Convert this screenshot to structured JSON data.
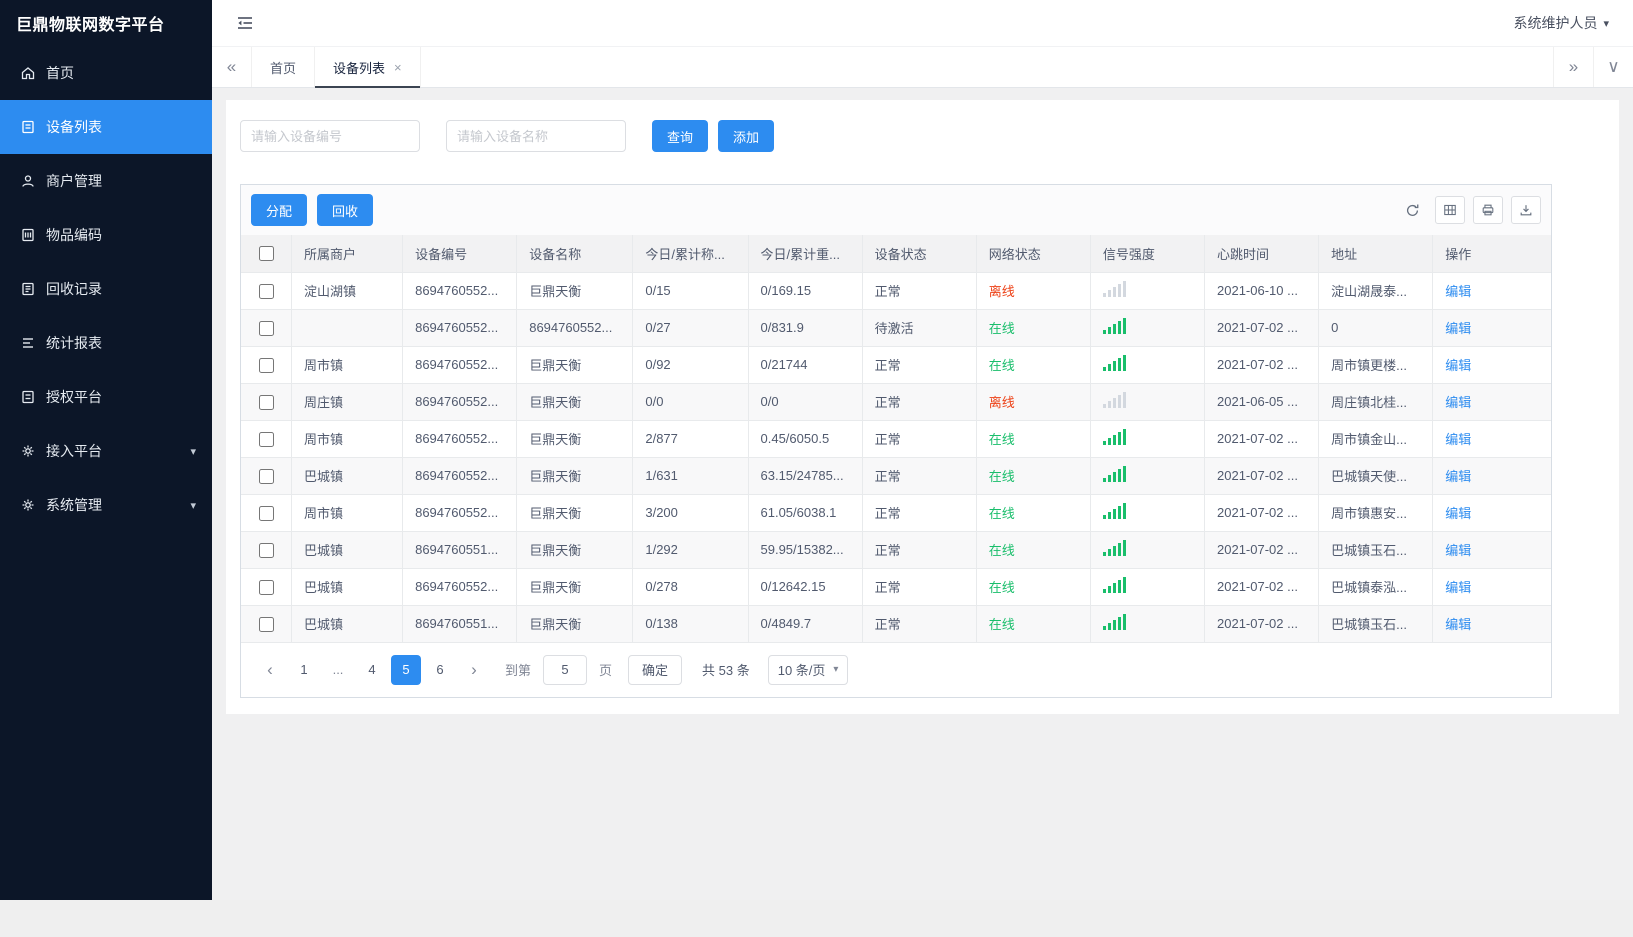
{
  "app": {
    "title": "巨鼎物联网数字平台"
  },
  "topbar": {
    "user": "系统维护人员"
  },
  "colors": {
    "accent": "#2d8cf0",
    "online_green": "#19be6b",
    "offline_red": "#ed3f14",
    "sidebar_bg": "#0c1628"
  },
  "icons": {
    "user_dropdown_arrow": "▾",
    "menu_expand_arrow": "▾",
    "tab_close": "×",
    "tab_scroll_left": "«",
    "tab_scroll_right": "»",
    "tab_list_arrow": "∨",
    "select_arrow": "▾"
  },
  "sidebar": {
    "items": [
      {
        "label": "首页",
        "icon": "home-icon",
        "active": false
      },
      {
        "label": "设备列表",
        "icon": "device-list-icon",
        "active": true
      },
      {
        "label": "商户管理",
        "icon": "merchant-icon",
        "active": false
      },
      {
        "label": "物品编码",
        "icon": "item-code-icon",
        "active": false
      },
      {
        "label": "回收记录",
        "icon": "recycle-record-icon",
        "active": false
      },
      {
        "label": "统计报表",
        "icon": "report-icon",
        "active": false
      },
      {
        "label": "授权平台",
        "icon": "auth-platform-icon",
        "active": false
      },
      {
        "label": "接入平台",
        "icon": "access-platform-icon",
        "active": false,
        "expandable": true
      },
      {
        "label": "系统管理",
        "icon": "system-manage-icon",
        "active": false,
        "expandable": true
      }
    ]
  },
  "tabs": {
    "items": [
      {
        "label": "首页",
        "active": false,
        "closable": false
      },
      {
        "label": "设备列表",
        "active": true,
        "closable": true
      }
    ]
  },
  "search": {
    "device_no_placeholder": "请输入设备编号",
    "device_name_placeholder": "请输入设备名称",
    "query_label": "查询",
    "add_label": "添加"
  },
  "toolbar": {
    "assign_label": "分配",
    "recycle_label": "回收"
  },
  "table": {
    "headers": [
      "所属商户",
      "设备编号",
      "设备名称",
      "今日/累计称...",
      "今日/累计重...",
      "设备状态",
      "网络状态",
      "信号强度",
      "心跳时间",
      "地址",
      "操作"
    ],
    "edit_label": "编辑",
    "rows": [
      {
        "merchant": "淀山湖镇",
        "device_no": "8694760552...",
        "device_name": "巨鼎天衡",
        "today_count": "0/15",
        "today_weight": "0/169.15",
        "device_status": "正常",
        "network_status": "离线",
        "network_state": "offline",
        "signal": "weak",
        "heartbeat": "2021-06-10 ...",
        "address": "淀山湖晟泰..."
      },
      {
        "merchant": "",
        "device_no": "8694760552...",
        "device_name": "8694760552...",
        "today_count": "0/27",
        "today_weight": "0/831.9",
        "device_status": "待激活",
        "network_status": "在线",
        "network_state": "online",
        "signal": "strong",
        "heartbeat": "2021-07-02 ...",
        "address": "0"
      },
      {
        "merchant": "周市镇",
        "device_no": "8694760552...",
        "device_name": "巨鼎天衡",
        "today_count": "0/92",
        "today_weight": "0/21744",
        "device_status": "正常",
        "network_status": "在线",
        "network_state": "online",
        "signal": "strong",
        "heartbeat": "2021-07-02 ...",
        "address": "周市镇更楼..."
      },
      {
        "merchant": "周庄镇",
        "device_no": "8694760552...",
        "device_name": "巨鼎天衡",
        "today_count": "0/0",
        "today_weight": "0/0",
        "device_status": "正常",
        "network_status": "离线",
        "network_state": "offline",
        "signal": "weak",
        "heartbeat": "2021-06-05 ...",
        "address": "周庄镇北桂..."
      },
      {
        "merchant": "周市镇",
        "device_no": "8694760552...",
        "device_name": "巨鼎天衡",
        "today_count": "2/877",
        "today_weight": "0.45/6050.5",
        "device_status": "正常",
        "network_status": "在线",
        "network_state": "online",
        "signal": "strong",
        "heartbeat": "2021-07-02 ...",
        "address": "周市镇金山..."
      },
      {
        "merchant": "巴城镇",
        "device_no": "8694760552...",
        "device_name": "巨鼎天衡",
        "today_count": "1/631",
        "today_weight": "63.15/24785...",
        "device_status": "正常",
        "network_status": "在线",
        "network_state": "online",
        "signal": "strong",
        "heartbeat": "2021-07-02 ...",
        "address": "巴城镇天使..."
      },
      {
        "merchant": "周市镇",
        "device_no": "8694760552...",
        "device_name": "巨鼎天衡",
        "today_count": "3/200",
        "today_weight": "61.05/6038.1",
        "device_status": "正常",
        "network_status": "在线",
        "network_state": "online",
        "signal": "strong",
        "heartbeat": "2021-07-02 ...",
        "address": "周市镇惠安..."
      },
      {
        "merchant": "巴城镇",
        "device_no": "8694760551...",
        "device_name": "巨鼎天衡",
        "today_count": "1/292",
        "today_weight": "59.95/15382...",
        "device_status": "正常",
        "network_status": "在线",
        "network_state": "online",
        "signal": "strong",
        "heartbeat": "2021-07-02 ...",
        "address": "巴城镇玉石..."
      },
      {
        "merchant": "巴城镇",
        "device_no": "8694760552...",
        "device_name": "巨鼎天衡",
        "today_count": "0/278",
        "today_weight": "0/12642.15",
        "device_status": "正常",
        "network_status": "在线",
        "network_state": "online",
        "signal": "strong",
        "heartbeat": "2021-07-02 ...",
        "address": "巴城镇泰泓..."
      },
      {
        "merchant": "巴城镇",
        "device_no": "8694760551...",
        "device_name": "巨鼎天衡",
        "today_count": "0/138",
        "today_weight": "0/4849.7",
        "device_status": "正常",
        "network_status": "在线",
        "network_state": "online",
        "signal": "strong",
        "heartbeat": "2021-07-02 ...",
        "address": "巴城镇玉石..."
      }
    ]
  },
  "pagination": {
    "pages": [
      {
        "label": "‹",
        "kind": "prev"
      },
      {
        "label": "1"
      },
      {
        "label": "...",
        "kind": "ellipsis"
      },
      {
        "label": "4"
      },
      {
        "label": "5",
        "active": true
      },
      {
        "label": "6"
      },
      {
        "label": "›",
        "kind": "next"
      }
    ],
    "jump_prefix": "到第",
    "jump_value": "5",
    "jump_suffix": "页",
    "confirm_label": "确定",
    "total_text": "共 53 条",
    "page_size": "10 条/页"
  }
}
